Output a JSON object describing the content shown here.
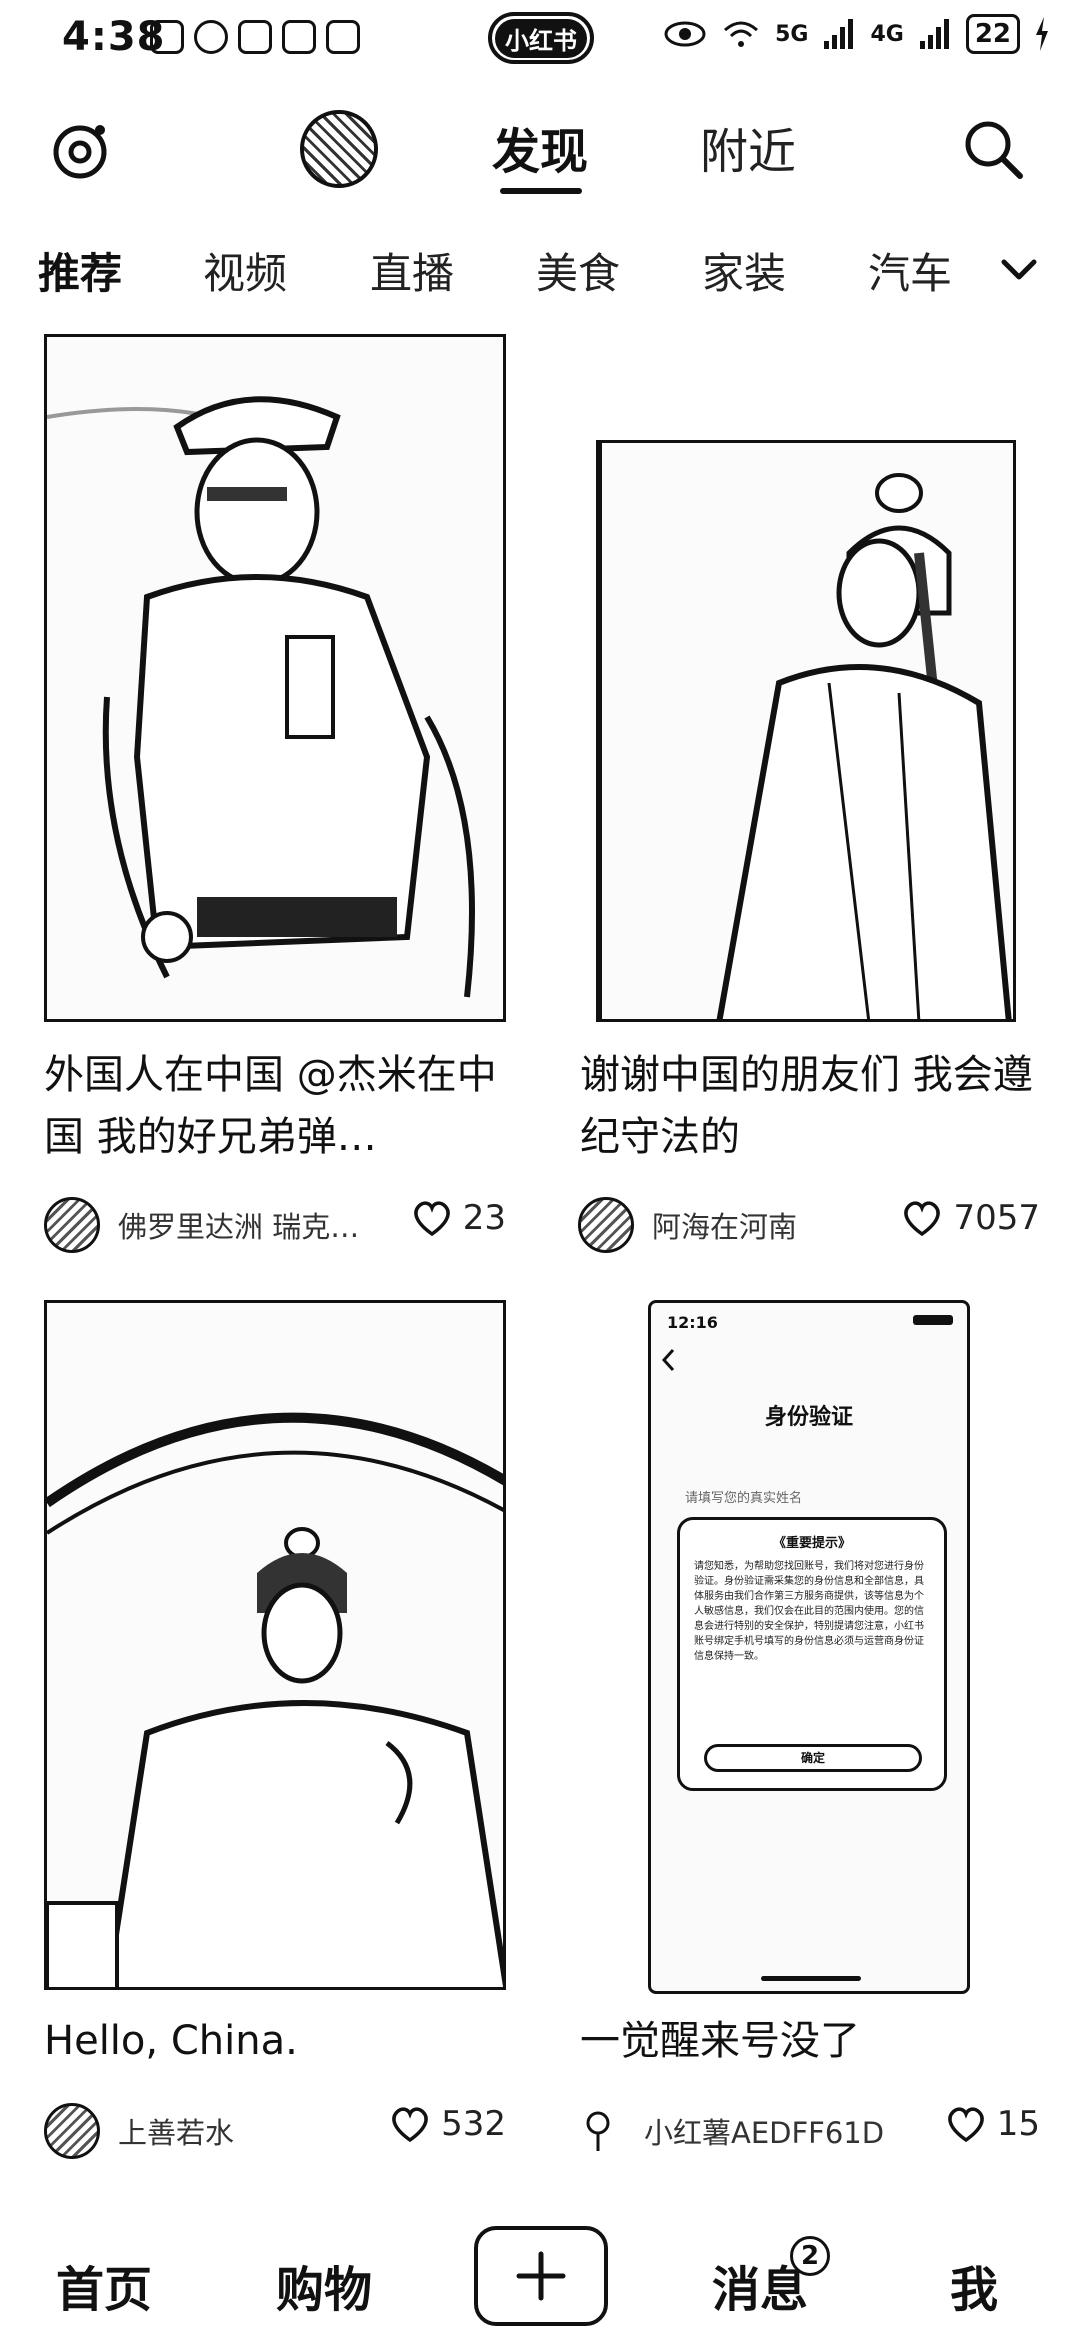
{
  "status_bar": {
    "time": "4:38",
    "app_pill": "小红书",
    "network_5g": "5G",
    "network_4g": "4G",
    "battery": "22"
  },
  "top_nav": {
    "tab_discover": "发现",
    "tab_nearby": "附近"
  },
  "categories": [
    "推荐",
    "视频",
    "直播",
    "美食",
    "家装",
    "汽车"
  ],
  "feed": [
    {
      "title": "外国人在中国 @杰米在中国 我的好兄弟弹…",
      "author": "佛罗里达洲 瑞克…",
      "likes": "23",
      "image_desc": "police-officer-photo"
    },
    {
      "title": "谢谢中国的朋友们 我会遵纪守法的",
      "author": "阿海在河南",
      "likes": "7057",
      "image_desc": "hanfu-man-photo"
    },
    {
      "title": "Hello, China.",
      "author": "上善若水",
      "likes": "532",
      "image_desc": "hanfu-man-seated-photo"
    },
    {
      "title": "一觉醒来号没了",
      "author": "小红薯AEDFF61D",
      "likes": "15",
      "image_desc": "identity-verification-screenshot",
      "screenshot": {
        "time": "12:16",
        "heading": "身份验证",
        "subtitle": "请填写您的真实姓名",
        "notice_title": "《重要提示》",
        "notice_body": "请您知悉，为帮助您找回账号，我们将对您进行身份验证。身份验证需采集您的身份信息和全部信息，具体服务由我们合作第三方服务商提供，该等信息为个人敏感信息，我们仅会在此目的范围内使用。您的信息会进行特别的安全保护，特别提请您注意，小红书账号绑定手机号填写的身份信息必须与运营商身份证信息保持一致。",
        "confirm": "确定"
      }
    }
  ],
  "bottom_nav": {
    "home": "首页",
    "shop": "购物",
    "messages": "消息",
    "messages_badge": "2",
    "me": "我"
  }
}
